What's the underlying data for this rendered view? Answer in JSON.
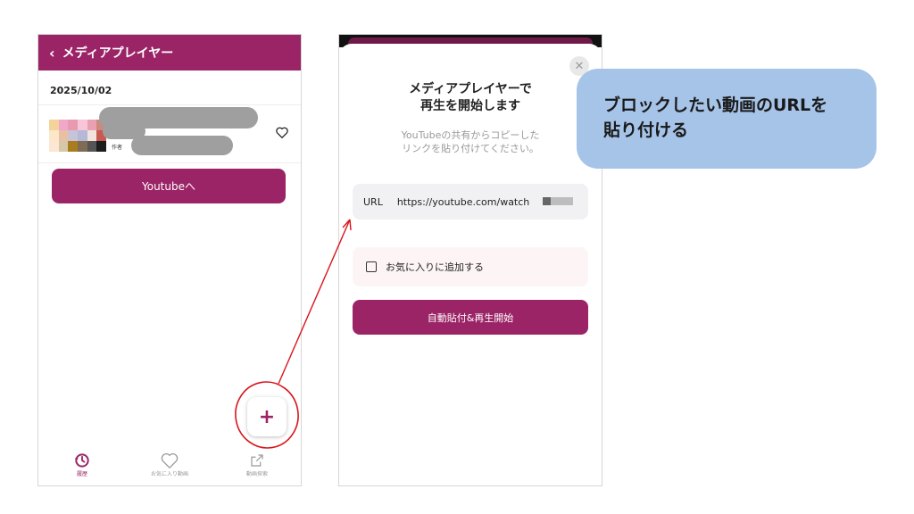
{
  "left_screen": {
    "header": {
      "back_icon": "chevron-left-icon",
      "title": "メディアプレイヤー"
    },
    "history": {
      "date": "2025/10/02",
      "item": {
        "author_label": "作者",
        "favorite_icon": "heart-outline-icon"
      }
    },
    "youtube_button": "Youtubeへ",
    "fab": {
      "icon": "plus-icon",
      "label": "+"
    },
    "bottom_nav": [
      {
        "label": "履歴",
        "icon": "history-icon",
        "active": true
      },
      {
        "label": "お気に入り動画",
        "icon": "heart-outline-icon",
        "active": false
      },
      {
        "label": "動画探索",
        "icon": "external-link-icon",
        "active": false
      }
    ]
  },
  "right_screen": {
    "close_icon": "close-icon",
    "title_line1": "メディアプレイヤーで",
    "title_line2": "再生を開始します",
    "subtitle_line1": "YouTubeの共有からコピーした",
    "subtitle_line2": "リンクを貼り付けてください。",
    "url_field": {
      "label": "URL",
      "value": "https://youtube.com/watch"
    },
    "favorite_checkbox_label": "お気に入りに追加する",
    "start_button": "自動貼付&再生開始"
  },
  "callout": {
    "line1": "ブロックしたい動画のURLを",
    "line2": "貼り付ける"
  },
  "colors": {
    "brand": "#9b2466",
    "callout_bg": "#a6c3e8",
    "annotation": "#d9141c"
  }
}
